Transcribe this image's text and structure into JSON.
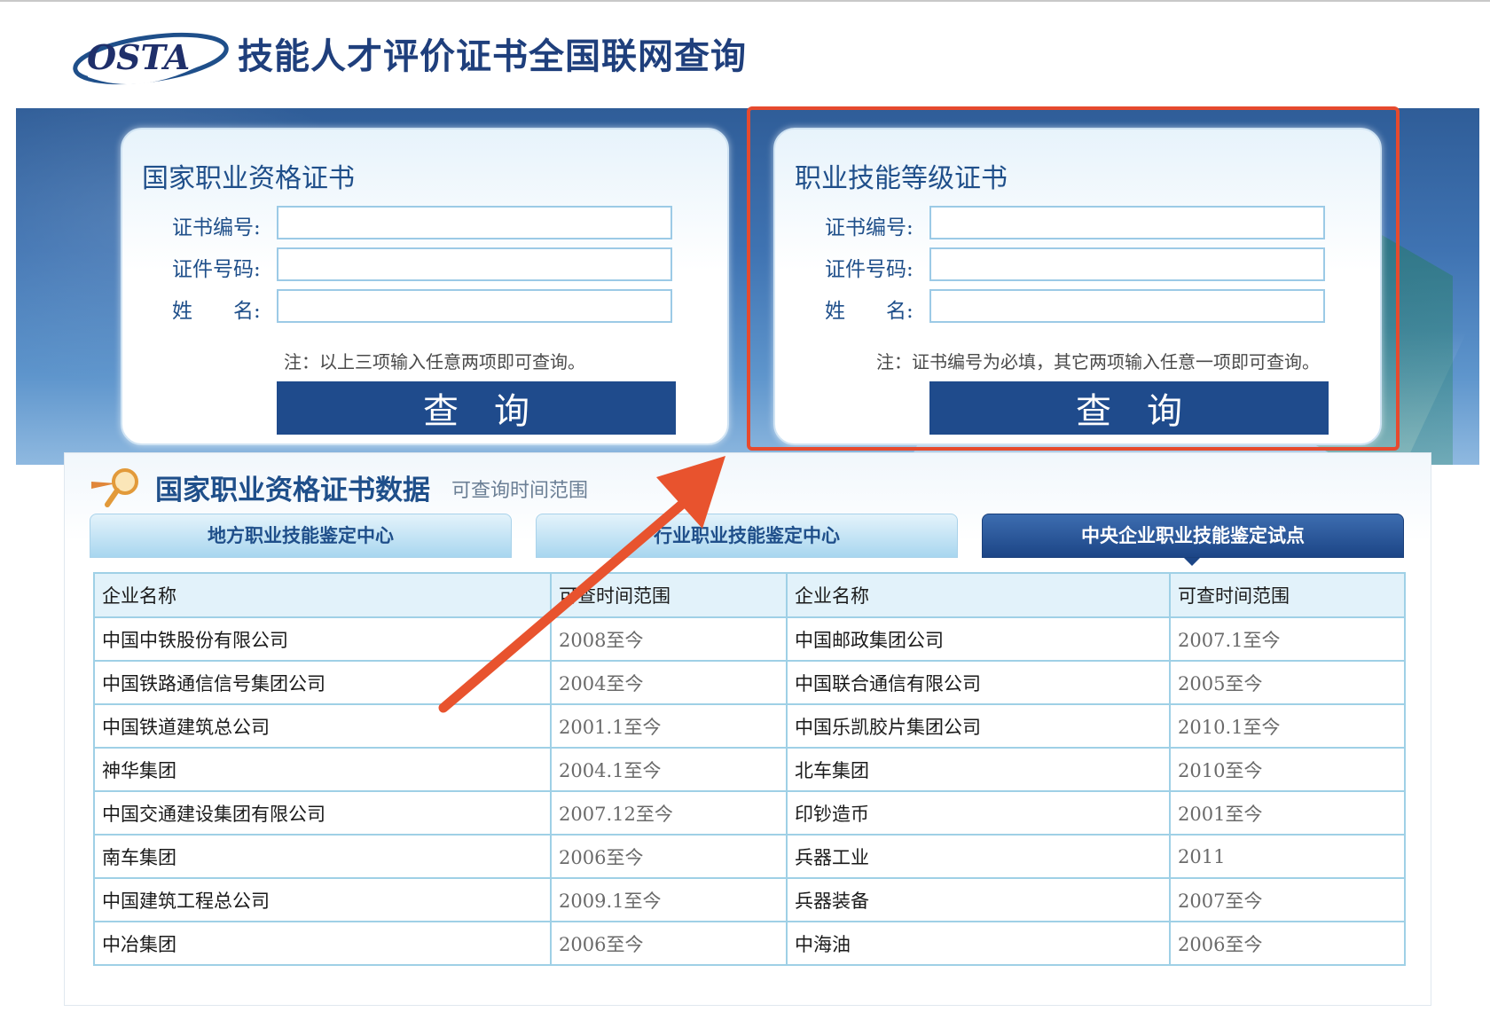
{
  "header": {
    "logo_text": "OSTA",
    "site_title": "技能人才评价证书全国联网查询"
  },
  "panels": {
    "left": {
      "title": "国家职业资格证书",
      "cert_no_label": "证书编号:",
      "id_no_label": "证件号码:",
      "name_label": "姓　　名:",
      "cert_no_value": "",
      "id_no_value": "",
      "name_value": "",
      "note": "注：以上三项输入任意两项即可查询。",
      "query_button": "查询"
    },
    "right": {
      "title": "职业技能等级证书",
      "cert_no_label": "证书编号:",
      "id_no_label": "证件号码:",
      "name_label": "姓　　名:",
      "cert_no_value": "",
      "id_no_value": "",
      "name_value": "",
      "note": "注：证书编号为必填，其它两项输入任意一项即可查询。",
      "query_button": "查询"
    }
  },
  "data_section": {
    "title": "国家职业资格证书数据",
    "subtitle": "可查询时间范围",
    "tabs": [
      {
        "label": "地方职业技能鉴定中心",
        "active": false
      },
      {
        "label": "行业职业技能鉴定中心",
        "active": false
      },
      {
        "label": "中央企业职业技能鉴定试点",
        "active": true
      }
    ],
    "table": {
      "headers": [
        "企业名称",
        "可查时间范围",
        "企业名称",
        "可查时间范围"
      ],
      "rows": [
        [
          "中国中铁股份有限公司",
          "2008至今",
          "中国邮政集团公司",
          "2007.1至今"
        ],
        [
          "中国铁路通信信号集团公司",
          "2004至今",
          "中国联合通信有限公司",
          "2005至今"
        ],
        [
          "中国铁道建筑总公司",
          "2001.1至今",
          "中国乐凯胶片集团公司",
          "2010.1至今"
        ],
        [
          "神华集团",
          "2004.1至今",
          "北车集团",
          "2010至今"
        ],
        [
          "中国交通建设集团有限公司",
          "2007.12至今",
          "印钞造币",
          "2001至今"
        ],
        [
          "南车集团",
          "2006至今",
          "兵器工业",
          "2011"
        ],
        [
          "中国建筑工程总公司",
          "2009.1至今",
          "兵器装备",
          "2007至今"
        ],
        [
          "中冶集团",
          "2006至今",
          "中海油",
          "2006至今"
        ]
      ]
    }
  },
  "colors": {
    "brand_blue": "#1f4b8c",
    "highlight_red": "#e64a2e",
    "table_border": "#9fd0e6"
  },
  "icons": {
    "logo": "osta-logo",
    "data_icon": "magnifier-icon",
    "annotation": "arrow-annotation"
  }
}
